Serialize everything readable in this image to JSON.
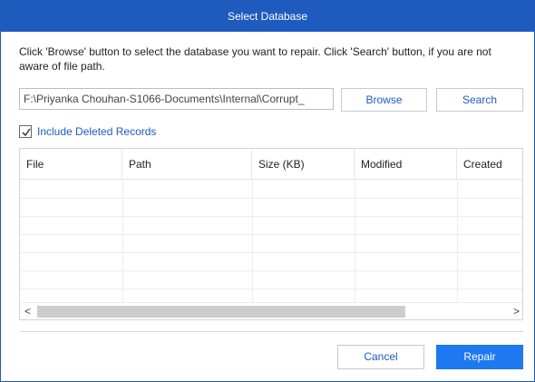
{
  "dialog": {
    "title": "Select Database",
    "instruction": "Click 'Browse' button to select the database you want to repair. Click 'Search' button, if you are not aware of file path."
  },
  "path_field": {
    "value": "F:\\Priyanka Chouhan-S1066-Documents\\Internal\\Corrupt_"
  },
  "buttons": {
    "browse": "Browse",
    "search": "Search",
    "cancel": "Cancel",
    "repair": "Repair"
  },
  "checkbox": {
    "label": "Include Deleted Records",
    "checked": true
  },
  "table": {
    "columns": [
      "File",
      "Path",
      "Size (KB)",
      "Modified",
      "Created"
    ],
    "rows": []
  },
  "scrollbar": {
    "left_arrow": "<",
    "right_arrow": ">"
  },
  "colors": {
    "title_bar": "#1e5bbf",
    "accent_text": "#1e5bbf",
    "primary_button": "#1e78f0"
  },
  "icons": {
    "checkbox_checkmark": "checkmark-icon"
  }
}
